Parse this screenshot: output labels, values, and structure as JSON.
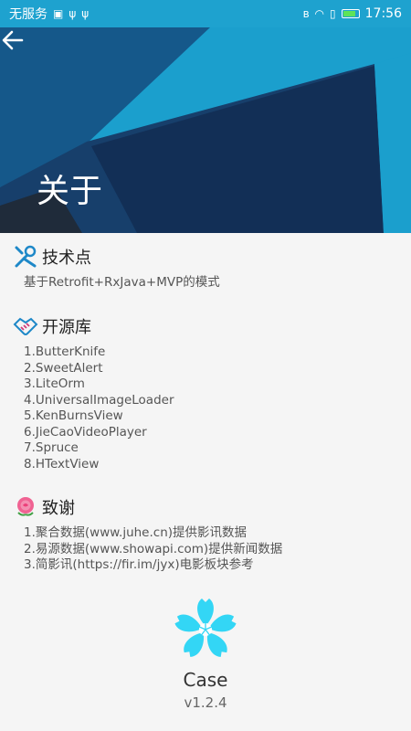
{
  "status_bar": {
    "carrier": "无服务",
    "time": "17:56"
  },
  "header": {
    "title": "关于"
  },
  "sections": {
    "tech": {
      "title": "技术点",
      "lines": [
        "基于Retrofit+RxJava+MVP的模式"
      ]
    },
    "libs": {
      "title": "开源库",
      "lines": [
        "1.ButterKnife",
        "2.SweetAlert",
        "3.LiteOrm",
        "4.UniversalImageLoader",
        "5.KenBurnsView",
        "6.JieCaoVideoPlayer",
        "7.Spruce",
        "8.HTextView"
      ]
    },
    "thanks": {
      "title": "致谢",
      "lines": [
        "1.聚合数据(www.juhe.cn)提供影讯数据",
        "2.易源数据(www.showapi.com)提供新闻数据",
        "3.简影讯(https://fir.im/jyx)电影板块参考"
      ]
    }
  },
  "app": {
    "name": "Case",
    "version": "v1.2.4"
  },
  "colors": {
    "accent": "#1ea2cf",
    "logo": "#33d6f5",
    "background": "#f5f5f5"
  }
}
